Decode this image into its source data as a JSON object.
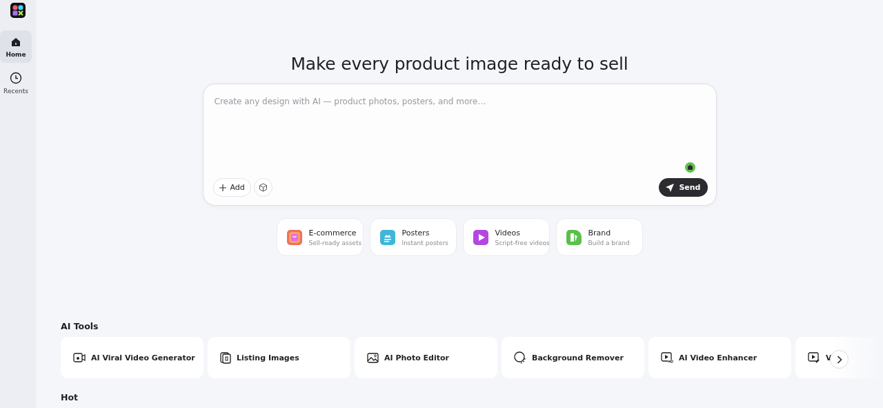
{
  "sidebar": {
    "items": [
      {
        "label": "Home",
        "kind": "home",
        "selected": true
      },
      {
        "label": "Recents",
        "kind": "clock",
        "selected": false
      }
    ]
  },
  "hero": {
    "title": "Make every product image ready to sell"
  },
  "prompt": {
    "placeholder": "Create any design with AI — product photos, posters, and more…",
    "add_label": "Add",
    "send_label": "Send"
  },
  "categories": [
    {
      "title": "E-commerce",
      "subtitle": "Sell-ready assets",
      "kind": "bag",
      "color": "#f0705a"
    },
    {
      "title": "Posters",
      "subtitle": "Instant posters",
      "kind": "poster",
      "color": "#3fb7d9"
    },
    {
      "title": "Videos",
      "subtitle": "Script-free videos",
      "kind": "play",
      "color": "#b447e0"
    },
    {
      "title": "Brand",
      "subtitle": "Build a brand",
      "kind": "brand",
      "color": "#5cbf4a"
    }
  ],
  "ai_tools": {
    "heading": "AI Tools",
    "items": [
      {
        "label": "AI Viral Video Generator",
        "kind": "camera"
      },
      {
        "label": "Listing Images",
        "kind": "cards"
      },
      {
        "label": "AI Photo Editor",
        "kind": "image"
      },
      {
        "label": "Background Remover",
        "kind": "circle"
      },
      {
        "label": "AI Video Enhancer",
        "kind": "hd"
      },
      {
        "label": "V",
        "kind": "edit"
      }
    ]
  },
  "hot": {
    "heading": "Hot"
  }
}
